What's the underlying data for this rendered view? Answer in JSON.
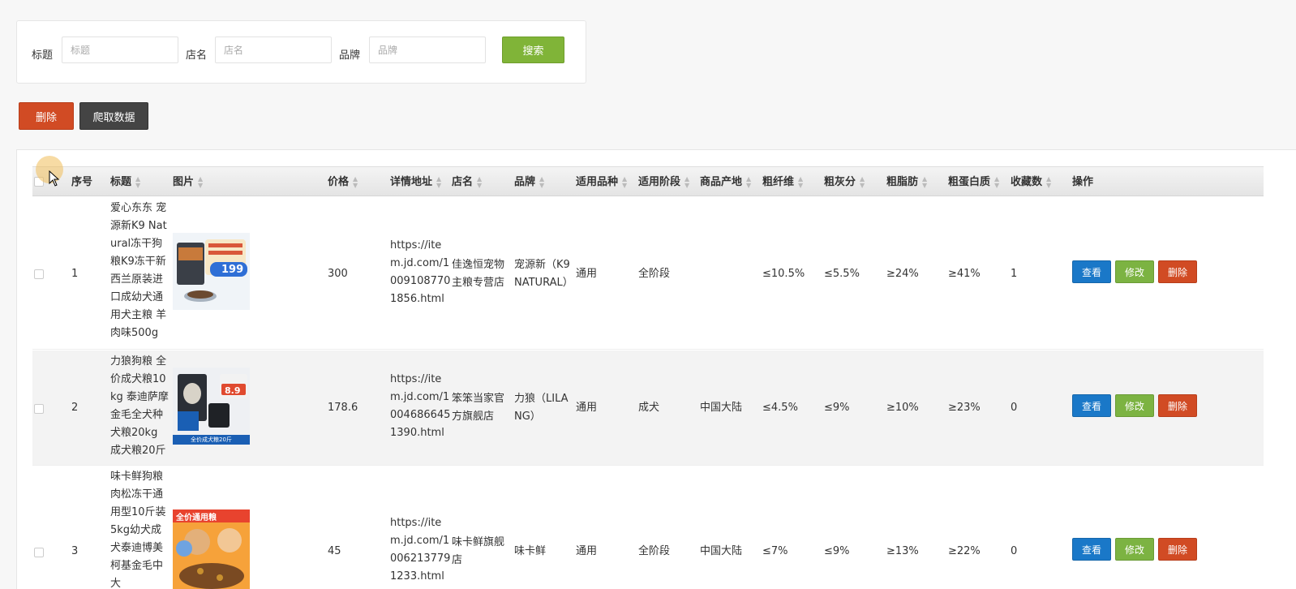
{
  "search": {
    "title_label": "标题",
    "title_placeholder": "标题",
    "shop_label": "店名",
    "shop_placeholder": "店名",
    "brand_label": "品牌",
    "brand_placeholder": "品牌",
    "search_button": "搜索"
  },
  "toolbar": {
    "delete_button": "删除",
    "crawl_button": "爬取数据"
  },
  "table": {
    "headers": {
      "index": "序号",
      "title": "标题",
      "image": "图片",
      "price": "价格",
      "detail_url": "详情地址",
      "shop": "店名",
      "brand": "品牌",
      "breed": "适用品种",
      "stage": "适用阶段",
      "origin": "商品产地",
      "fiber": "粗纤维",
      "ash": "粗灰分",
      "fat": "粗脂肪",
      "protein": "粗蛋白质",
      "favorites": "收藏数",
      "actions": "操作"
    },
    "rows": [
      {
        "index": "1",
        "title": "爱心东东 宠源新K9 Natural冻干狗粮K9冻干新西兰原装进口成幼犬通用犬主粮 羊肉味500g",
        "image_badge": "199",
        "price": "300",
        "detail_url": "https://item.jd.com/10091087701856.html",
        "shop": "佳逸恒宠物主粮专营店",
        "brand": "宠源新（K9 NATURAL）",
        "breed": "通用",
        "stage": "全阶段",
        "origin": "",
        "fiber": "≤10.5%",
        "ash": "≤5.5%",
        "fat": "≥24%",
        "protein": "≥41%",
        "favorites": "1"
      },
      {
        "index": "2",
        "title": "力狼狗粮 全价成犬粮10kg 泰迪萨摩金毛全犬种犬粮20kg 成犬粮20斤",
        "image_badge": "8.9",
        "image_caption": "全价成犬粮20斤",
        "price": "178.6",
        "detail_url": "https://item.jd.com/10046866451390.html",
        "shop": "笨笨当家官方旗舰店",
        "brand": "力狼（LILANG）",
        "breed": "通用",
        "stage": "成犬",
        "origin": "中国大陆",
        "fiber": "≤4.5%",
        "ash": "≤9%",
        "fat": "≥10%",
        "protein": "≥23%",
        "favorites": "0"
      },
      {
        "index": "3",
        "title": "味卡鲜狗粮 肉松冻干通用型10斤装5kg幼犬成犬泰迪博美柯基金毛中大",
        "image_badge": "全价通用粮",
        "price": "45",
        "detail_url": "https://item.jd.com/10062137791233.html",
        "shop": "味卡鲜旗舰店",
        "brand": "味卡鲜",
        "breed": "通用",
        "stage": "全阶段",
        "origin": "中国大陆",
        "fiber": "≤7%",
        "ash": "≤9%",
        "fat": "≥13%",
        "protein": "≥22%",
        "favorites": "0"
      }
    ],
    "row_actions": {
      "view": "查看",
      "edit": "修改",
      "delete": "删除"
    }
  },
  "colors": {
    "search_green": "#80b438",
    "danger_red": "#d14b24",
    "dark_button": "#444444",
    "view_blue": "#1a78c8",
    "edit_green": "#7cb342"
  }
}
